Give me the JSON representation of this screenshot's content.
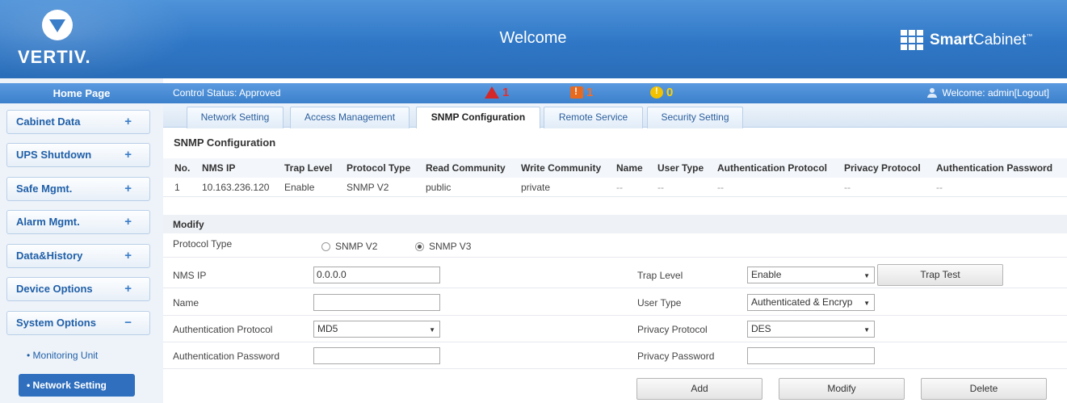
{
  "header": {
    "logo_text": "VERTIV.",
    "title": "Welcome",
    "brand_bold": "Smart",
    "brand_rest": "Cabinet",
    "brand_tm": "™"
  },
  "status": {
    "control_status": "Control Status:  Approved",
    "critical_count": "1",
    "major_count": "1",
    "minor_count": "0",
    "welcome_user": "Welcome: admin[Logout]"
  },
  "sidebar": {
    "home": "Home Page",
    "items": [
      {
        "label": "Cabinet Data",
        "sign": "+"
      },
      {
        "label": "UPS Shutdown",
        "sign": "+"
      },
      {
        "label": "Safe Mgmt.",
        "sign": "+"
      },
      {
        "label": "Alarm Mgmt.",
        "sign": "+"
      },
      {
        "label": "Data&History",
        "sign": "+"
      },
      {
        "label": "Device Options",
        "sign": "+"
      },
      {
        "label": "System Options",
        "sign": "−"
      }
    ],
    "sub_items": [
      "• Monitoring Unit",
      "• Network Setting"
    ]
  },
  "tabs": [
    "Network Setting",
    "Access Management",
    "SNMP Configuration",
    "Remote Service",
    "Security Setting"
  ],
  "active_tab": "SNMP Configuration",
  "snmp": {
    "section_title": "SNMP Configuration",
    "columns": [
      "No.",
      "NMS IP",
      "Trap Level",
      "Protocol Type",
      "Read Community",
      "Write Community",
      "Name",
      "User Type",
      "Authentication Protocol",
      "Privacy Protocol",
      "Authentication Password"
    ],
    "rows": [
      [
        "1",
        "10.163.236.120",
        "Enable",
        "SNMP V2",
        "public",
        "private",
        "--",
        "--",
        "--",
        "--",
        "--"
      ]
    ]
  },
  "modify": {
    "section_title": "Modify",
    "protocol_type_label": "Protocol Type",
    "protocol_options": [
      "SNMP V2",
      "SNMP V3"
    ],
    "protocol_selected": "SNMP V3",
    "nms_ip_label": "NMS IP",
    "nms_ip_value": "0.0.0.0",
    "trap_level_label": "Trap Level",
    "trap_level_value": "Enable",
    "trap_test_label": "Trap Test",
    "name_label": "Name",
    "name_value": "",
    "user_type_label": "User Type",
    "user_type_value": "Authenticated & Encryp",
    "auth_protocol_label": "Authentication Protocol",
    "auth_protocol_value": "MD5",
    "privacy_protocol_label": "Privacy Protocol",
    "privacy_protocol_value": "DES",
    "auth_password_label": "Authentication Password",
    "auth_password_value": "",
    "privacy_password_label": "Privacy Password",
    "privacy_password_value": "",
    "add_label": "Add",
    "modify_label": "Modify",
    "delete_label": "Delete"
  },
  "colors": {
    "header_blue": "#2f77c6",
    "critical": "#e03030",
    "major": "#ff6a1a",
    "minor": "#ffd200",
    "active_nav": "#2f6fbe"
  },
  "icons": [
    "vertiv-logo-icon",
    "smartcabinet-grid-icon",
    "critical-alarm-icon",
    "major-alarm-icon",
    "minor-alarm-icon",
    "user-icon"
  ]
}
